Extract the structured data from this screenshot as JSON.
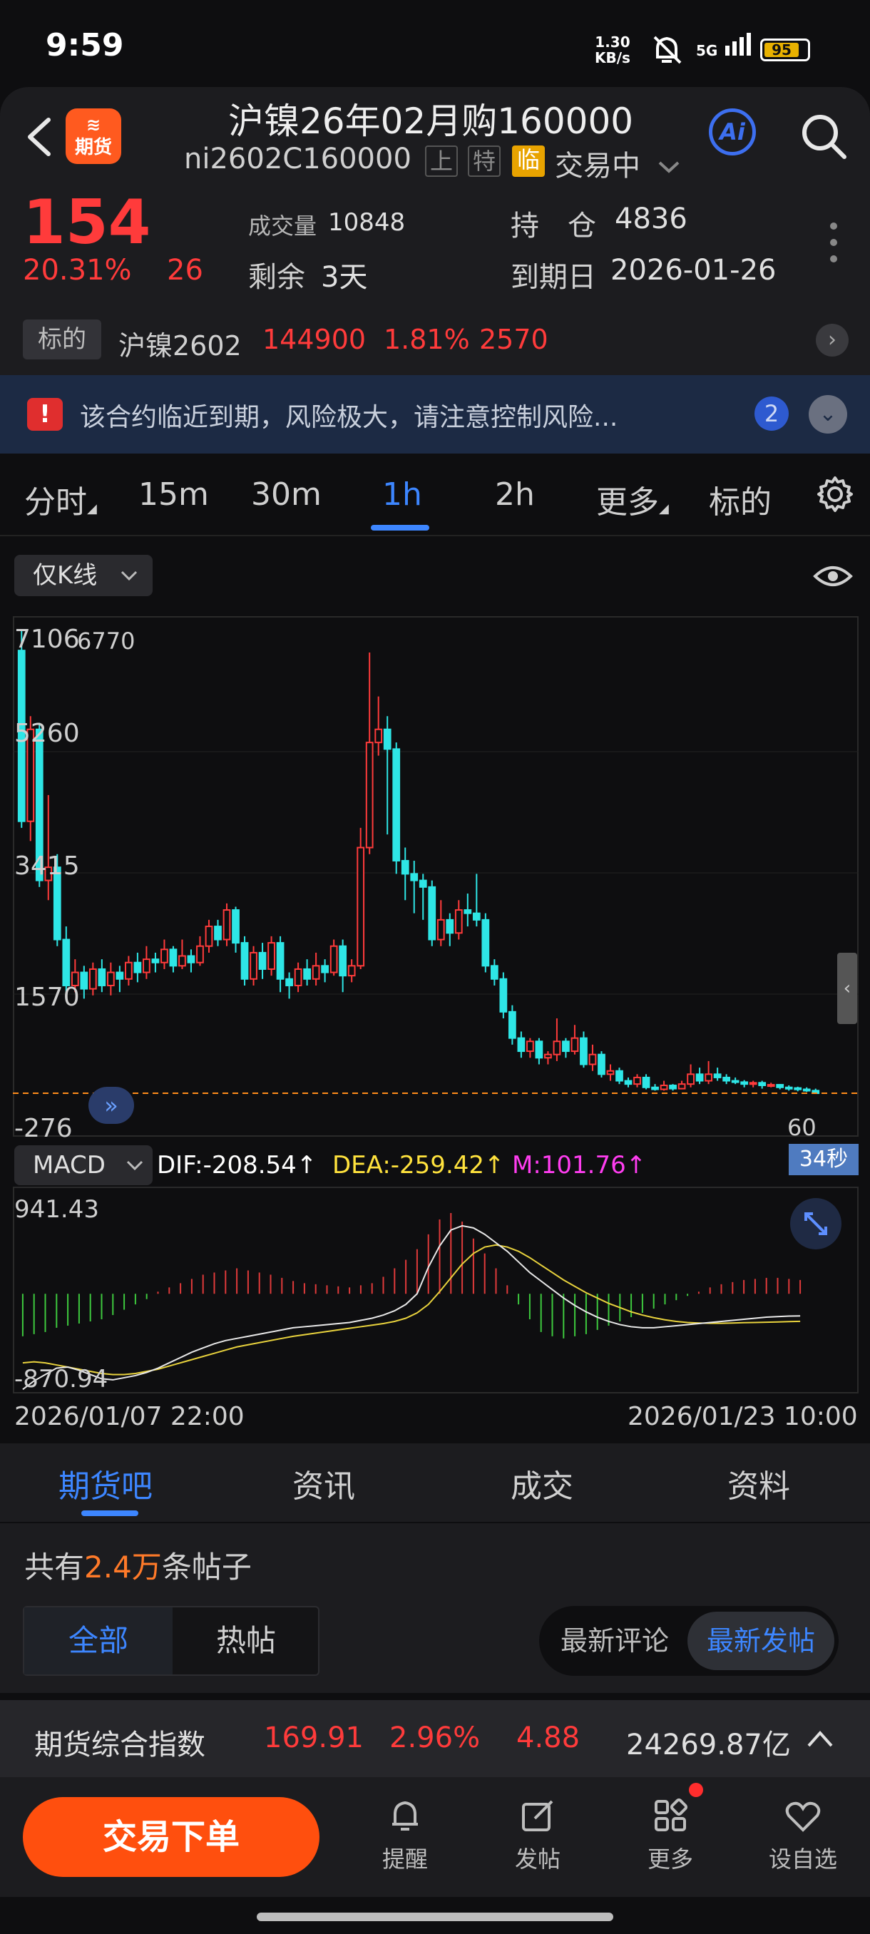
{
  "status_bar": {
    "time": "9:59",
    "net_speed": "1.30",
    "net_unit": "KB/s",
    "signal": "5G",
    "battery": "95"
  },
  "header": {
    "logo_top": "≋",
    "logo_label": "期货",
    "title": "沪镍26年02月购160000",
    "contract_code": "ni2602C160000",
    "tag_exchange": "上",
    "tag_special": "特",
    "tag_near": "临",
    "trade_status": "交易中",
    "ai_label": "Ai"
  },
  "quote": {
    "price": "154",
    "change_pct": "20.31%",
    "change": "26",
    "volume_label": "成交量",
    "volume": "10848",
    "remaining_label": "剩余",
    "remaining": "3天",
    "oi_label": "持　仓",
    "oi": "4836",
    "expiry_label": "到期日",
    "expiry": "2026-01-26"
  },
  "underlying": {
    "tag": "标的",
    "name": "沪镍2602",
    "price": "144900",
    "pct": "1.81%",
    "change": "2570"
  },
  "warning": {
    "icon": "!",
    "text": "该合约临近到期，风险极大，请注意控制风险...",
    "count": "2"
  },
  "period_tabs": [
    "分时",
    "15m",
    "30m",
    "1h",
    "2h",
    "更多",
    "标的"
  ],
  "chart": {
    "kline_select": "仅K线",
    "y_labels": [
      "7106",
      "5260",
      "3415",
      "1570",
      "-276"
    ],
    "max_label": "6770",
    "last_label": "60",
    "timer": "34秒",
    "macd_select": "MACD",
    "dif": "DIF:-208.54↑",
    "dea": "DEA:-259.42↑",
    "m": "M:101.76↑",
    "macd_top": "941.43",
    "macd_bottom": "-870.94",
    "date_start": "2026/01/07 22:00",
    "date_end": "2026/01/23 10:00"
  },
  "chart_data": {
    "type": "candlestick",
    "y_range": [
      -276,
      7106
    ],
    "candles": [
      [
        6800,
        4200,
        7106,
        4100
      ],
      [
        4200,
        5600,
        5800,
        3900
      ],
      [
        5600,
        3300,
        5700,
        3200
      ],
      [
        3300,
        3500,
        4600,
        3000
      ],
      [
        3500,
        2400,
        3700,
        2300
      ],
      [
        2400,
        1700,
        2600,
        1500
      ],
      [
        1700,
        1900,
        2100,
        1600
      ],
      [
        1900,
        1650,
        2000,
        1500
      ],
      [
        1650,
        1950,
        2050,
        1550
      ],
      [
        1950,
        1700,
        2100,
        1600
      ],
      [
        1700,
        1900,
        2050,
        1550
      ],
      [
        1900,
        1800,
        2000,
        1600
      ],
      [
        1800,
        2050,
        2150,
        1700
      ],
      [
        2050,
        1900,
        2200,
        1750
      ],
      [
        1900,
        2100,
        2300,
        1800
      ],
      [
        2100,
        2050,
        2200,
        1900
      ],
      [
        2050,
        2250,
        2400,
        1950
      ],
      [
        2250,
        2000,
        2300,
        1900
      ],
      [
        2000,
        2150,
        2400,
        1950
      ],
      [
        2150,
        2050,
        2250,
        1900
      ],
      [
        2050,
        2300,
        2450,
        2000
      ],
      [
        2300,
        2600,
        2700,
        2200
      ],
      [
        2600,
        2400,
        2700,
        2300
      ],
      [
        2400,
        2850,
        2950,
        2300
      ],
      [
        2850,
        2350,
        2900,
        2200
      ],
      [
        2350,
        1800,
        2450,
        1700
      ],
      [
        1800,
        2200,
        2300,
        1700
      ],
      [
        2200,
        1950,
        2350,
        1800
      ],
      [
        1950,
        2350,
        2450,
        1850
      ],
      [
        2350,
        1800,
        2450,
        1600
      ],
      [
        1800,
        1700,
        1900,
        1500
      ],
      [
        1700,
        1950,
        2050,
        1600
      ],
      [
        1950,
        1800,
        2100,
        1700
      ],
      [
        1800,
        2000,
        2200,
        1700
      ],
      [
        2000,
        1900,
        2100,
        1750
      ],
      [
        1900,
        2300,
        2400,
        1850
      ],
      [
        2300,
        1850,
        2400,
        1600
      ],
      [
        1850,
        2000,
        2100,
        1750
      ],
      [
        2000,
        3800,
        4100,
        1950
      ],
      [
        3800,
        5400,
        6770,
        3700
      ],
      [
        5400,
        5600,
        6100,
        5200
      ],
      [
        5600,
        5300,
        5800,
        4000
      ],
      [
        5300,
        3600,
        5400,
        3400
      ],
      [
        3600,
        3400,
        3800,
        3000
      ],
      [
        3400,
        3300,
        3600,
        2800
      ],
      [
        3300,
        3200,
        3400,
        2700
      ],
      [
        3200,
        2400,
        3300,
        2300
      ],
      [
        2400,
        2700,
        3000,
        2300
      ],
      [
        2700,
        2500,
        2800,
        2300
      ],
      [
        2500,
        2850,
        3000,
        2400
      ],
      [
        2850,
        2800,
        3100,
        2600
      ],
      [
        2800,
        2700,
        3400,
        2600
      ],
      [
        2700,
        2000,
        2800,
        1900
      ],
      [
        2000,
        1800,
        2100,
        1700
      ],
      [
        1800,
        1300,
        1900,
        1200
      ],
      [
        1300,
        900,
        1400,
        800
      ],
      [
        900,
        700,
        1000,
        600
      ],
      [
        700,
        850,
        900,
        600
      ],
      [
        850,
        600,
        900,
        500
      ],
      [
        600,
        650,
        700,
        500
      ],
      [
        650,
        850,
        1200,
        550
      ],
      [
        850,
        700,
        900,
        600
      ],
      [
        700,
        900,
        1100,
        650
      ],
      [
        900,
        500,
        1000,
        450
      ],
      [
        500,
        650,
        800,
        400
      ],
      [
        650,
        350,
        700,
        300
      ],
      [
        350,
        400,
        500,
        250
      ],
      [
        400,
        250,
        450,
        200
      ],
      [
        250,
        200,
        300,
        150
      ],
      [
        200,
        300,
        350,
        150
      ],
      [
        300,
        150,
        350,
        120
      ],
      [
        150,
        120,
        200,
        100
      ],
      [
        120,
        180,
        250,
        100
      ],
      [
        180,
        130,
        200,
        100
      ],
      [
        130,
        200,
        250,
        120
      ],
      [
        200,
        350,
        500,
        150
      ],
      [
        350,
        250,
        450,
        200
      ],
      [
        250,
        350,
        550,
        200
      ],
      [
        350,
        300,
        450,
        250
      ],
      [
        300,
        250,
        350,
        200
      ],
      [
        250,
        230,
        300,
        200
      ],
      [
        230,
        200,
        260,
        150
      ],
      [
        200,
        220,
        250,
        150
      ],
      [
        220,
        180,
        250,
        130
      ],
      [
        180,
        190,
        220,
        150
      ],
      [
        190,
        150,
        200,
        120
      ],
      [
        150,
        140,
        180,
        100
      ],
      [
        140,
        120,
        160,
        90
      ],
      [
        120,
        100,
        150,
        80
      ],
      [
        100,
        60,
        130,
        50
      ]
    ],
    "macd_range": [
      -870.94,
      941.43
    ],
    "dif_line": [
      -900,
      -820,
      -760,
      -700,
      -690,
      -720,
      -760,
      -800,
      -810,
      -790,
      -770,
      -740,
      -700,
      -650,
      -600,
      -550,
      -510,
      -470,
      -440,
      -420,
      -400,
      -380,
      -360,
      -340,
      -320,
      -310,
      -300,
      -290,
      -280,
      -270,
      -250,
      -230,
      -200,
      -160,
      -100,
      0,
      250,
      450,
      600,
      640,
      620,
      560,
      480,
      400,
      300,
      200,
      120,
      40,
      -40,
      -110,
      -170,
      -220,
      -260,
      -290,
      -310,
      -320,
      -320,
      -310,
      -300,
      -290,
      -280,
      -270,
      -260,
      -250,
      -240,
      -230,
      -220,
      -215,
      -210,
      -208
    ],
    "dea_line": [
      -650,
      -640,
      -650,
      -670,
      -690,
      -710,
      -730,
      -750,
      -760,
      -760,
      -750,
      -730,
      -710,
      -680,
      -650,
      -620,
      -590,
      -560,
      -530,
      -500,
      -480,
      -460,
      -440,
      -420,
      -400,
      -385,
      -370,
      -355,
      -340,
      -325,
      -310,
      -295,
      -280,
      -260,
      -230,
      -180,
      -100,
      20,
      150,
      280,
      380,
      440,
      460,
      440,
      400,
      340,
      270,
      200,
      130,
      70,
      10,
      -40,
      -90,
      -130,
      -170,
      -200,
      -225,
      -245,
      -260,
      -270,
      -275,
      -278,
      -278,
      -275,
      -272,
      -270,
      -268,
      -265,
      -262,
      -259
    ],
    "macd_hist": [
      -400,
      -380,
      -360,
      -320,
      -300,
      -280,
      -260,
      -240,
      -200,
      -150,
      -100,
      -50,
      20,
      60,
      100,
      140,
      180,
      200,
      220,
      240,
      220,
      200,
      180,
      150,
      120,
      100,
      90,
      80,
      70,
      60,
      80,
      100,
      160,
      240,
      320,
      420,
      560,
      700,
      760,
      680,
      520,
      380,
      240,
      80,
      -100,
      -240,
      -360,
      -400,
      -420,
      -400,
      -380,
      -340,
      -300,
      -260,
      -220,
      -180,
      -140,
      -100,
      -60,
      -20,
      20,
      60,
      90,
      110,
      130,
      140,
      150,
      150,
      140,
      130
    ],
    "dates": [
      "2026/01/07 22:00",
      "2026/01/23 10:00"
    ]
  },
  "bottom_tabs": [
    "期货吧",
    "资讯",
    "成交",
    "资料"
  ],
  "posts": {
    "prefix": "共有",
    "count": "2.4万",
    "suffix": "条帖子",
    "filter_all": "全部",
    "filter_hot": "热帖",
    "sort_comment": "最新评论",
    "sort_new": "最新发帖"
  },
  "index_bar": {
    "name": "期货综合指数",
    "value": "169.91",
    "pct": "2.96%",
    "change": "4.88",
    "amount": "24269.87亿"
  },
  "bottom_nav": {
    "order": "交易下单",
    "remind": "提醒",
    "post": "发帖",
    "more": "更多",
    "watch": "设自选"
  },
  "colors": {
    "up": "#ff3b3b",
    "down": "#2ee6e6",
    "accent": "#3d86ff",
    "order_button": "#ff4f0e"
  }
}
